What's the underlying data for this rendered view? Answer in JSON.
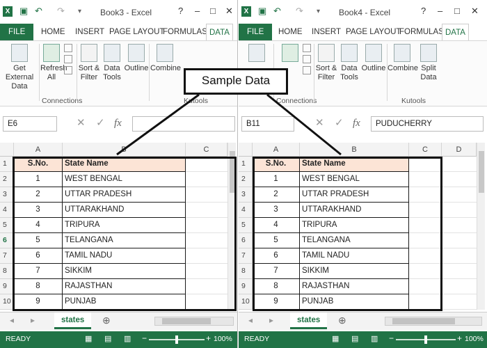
{
  "left": {
    "title": "Book3 - Excel",
    "tabs": [
      "FILE",
      "HOME",
      "INSERT",
      "PAGE LAYOUT",
      "FORMULAS",
      "DATA"
    ],
    "ribbon": {
      "get_external": "Get External",
      "get_external2": "Data",
      "refresh": "Refresh",
      "refresh2": "All",
      "sort": "Sort &",
      "sort2": "Filter",
      "data_tools": "Data",
      "data_tools2": "Tools",
      "outline": "Outline",
      "combine": "Combine",
      "group_connections": "Connections",
      "group_kutools": "Kutools"
    },
    "name_box": "E6",
    "columns": [
      "A",
      "B",
      "C"
    ],
    "rows": [
      "1",
      "2",
      "3",
      "4",
      "5",
      "6",
      "7",
      "8",
      "9",
      "10"
    ],
    "sheet_tab": "states",
    "status": "READY",
    "zoom": "100%"
  },
  "right": {
    "title": "Book4 - Excel",
    "tabs": [
      "FILE",
      "HOME",
      "INSERT",
      "PAGE LAYOUT",
      "FORMULAS",
      "DATA"
    ],
    "ribbon": {
      "sort": "Sort &",
      "sort2": "Filter",
      "data_tools": "Data",
      "data_tools2": "Tools",
      "outline": "Outline",
      "combine": "Combine",
      "split": "Split",
      "split2": "Data",
      "group_connections": "Connections",
      "group_kutools": "Kutools"
    },
    "name_box": "B11",
    "formula_value": "PUDUCHERRY",
    "columns": [
      "A",
      "B",
      "C",
      "D"
    ],
    "rows": [
      "1",
      "2",
      "3",
      "4",
      "5",
      "6",
      "7",
      "8",
      "9",
      "10"
    ],
    "sheet_tab": "states",
    "status": "READY",
    "zoom": "100%"
  },
  "table": {
    "header_sno": "S.No.",
    "header_name": "State Name",
    "rows": [
      {
        "sno": "1",
        "name": "WEST BENGAL"
      },
      {
        "sno": "2",
        "name": "UTTAR PRADESH"
      },
      {
        "sno": "3",
        "name": "UTTARAKHAND"
      },
      {
        "sno": "4",
        "name": "TRIPURA"
      },
      {
        "sno": "5",
        "name": "TELANGANA"
      },
      {
        "sno": "6",
        "name": "TAMIL NADU"
      },
      {
        "sno": "7",
        "name": "SIKKIM"
      },
      {
        "sno": "8",
        "name": "RAJASTHAN"
      },
      {
        "sno": "9",
        "name": "PUNJAB"
      }
    ]
  },
  "callout": "Sample Data",
  "colors": {
    "excel_green": "#217346",
    "header_fill": "#fce4d6"
  }
}
